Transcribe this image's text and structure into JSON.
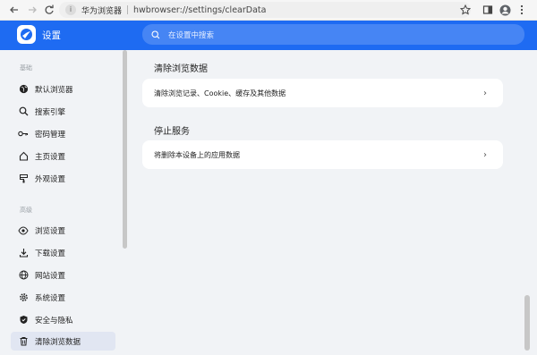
{
  "browser": {
    "site_name": "华为浏览器",
    "url": "hwbrowser://settings/clearData"
  },
  "header": {
    "title": "设置",
    "search_placeholder": "在设置中搜索"
  },
  "sidebar": {
    "section_basic": "基础",
    "section_advanced": "高级",
    "items": [
      {
        "label": "默认浏览器",
        "icon": "globe-icon"
      },
      {
        "label": "搜索引擎",
        "icon": "search-icon"
      },
      {
        "label": "密码管理",
        "icon": "key-icon"
      },
      {
        "label": "主页设置",
        "icon": "home-icon"
      },
      {
        "label": "外观设置",
        "icon": "appearance-icon"
      },
      {
        "label": "浏览设置",
        "icon": "eye-icon"
      },
      {
        "label": "下载设置",
        "icon": "download-icon"
      },
      {
        "label": "网站设置",
        "icon": "web-icon"
      },
      {
        "label": "系统设置",
        "icon": "gear-icon"
      },
      {
        "label": "安全与隐私",
        "icon": "shield-icon"
      },
      {
        "label": "清除浏览数据",
        "icon": "trash-icon"
      }
    ]
  },
  "main": {
    "clear_title": "清除浏览数据",
    "clear_card_label": "清除浏览记录、Cookie、缓存及其他数据",
    "stop_title": "停止服务",
    "stop_card_label": "将删除本设备上的应用数据"
  },
  "colors": {
    "accent": "#1e6bf2",
    "background": "#f1f3f6",
    "active_item": "#e1e6f2"
  }
}
